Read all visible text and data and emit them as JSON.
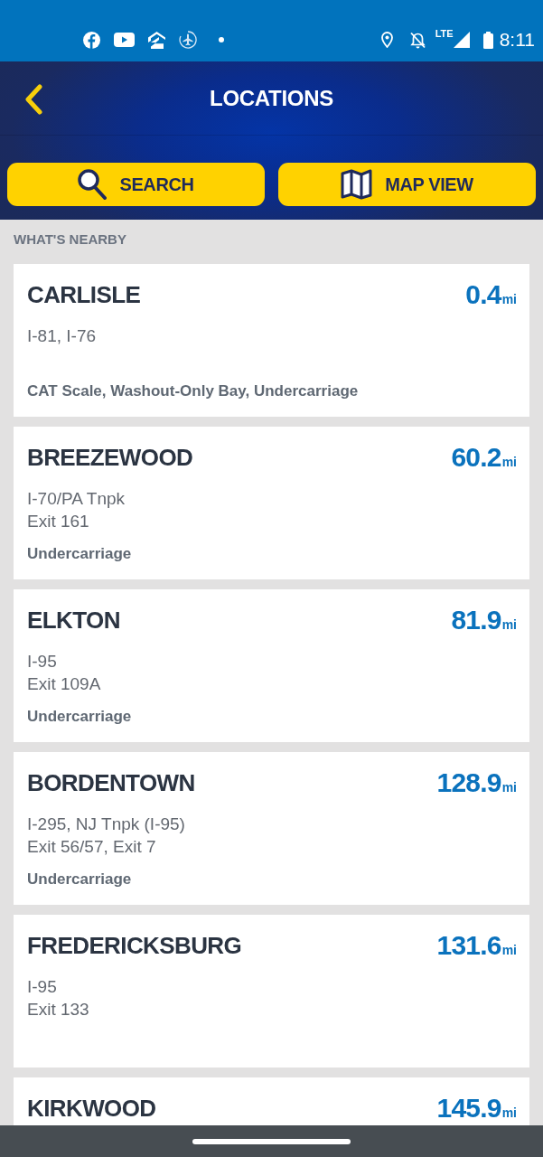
{
  "status_bar": {
    "network": "LTE",
    "time": "8:11"
  },
  "header": {
    "title": "LOCATIONS"
  },
  "actions": [
    {
      "kind": "search",
      "label": "SEARCH"
    },
    {
      "kind": "map",
      "label": "MAP VIEW"
    }
  ],
  "section": {
    "title": "WHAT'S NEARBY"
  },
  "locations": [
    {
      "name": "CARLISLE",
      "distance": "0.4",
      "unit": "mi",
      "roads": [
        "I-81, I-76"
      ],
      "amenities": "CAT Scale, Washout-Only Bay, Undercarriage"
    },
    {
      "name": "BREEZEWOOD",
      "distance": "60.2",
      "unit": "mi",
      "roads": [
        "I-70/PA Tnpk",
        "Exit 161"
      ],
      "amenities": "Undercarriage"
    },
    {
      "name": "ELKTON",
      "distance": "81.9",
      "unit": "mi",
      "roads": [
        "I-95",
        "Exit 109A"
      ],
      "amenities": "Undercarriage"
    },
    {
      "name": "BORDENTOWN",
      "distance": "128.9",
      "unit": "mi",
      "roads": [
        "I-295, NJ Tnpk (I-95)",
        "Exit 56/57, Exit 7"
      ],
      "amenities": "Undercarriage"
    },
    {
      "name": "FREDERICKSBURG",
      "distance": "131.6",
      "unit": "mi",
      "roads": [
        "I-95",
        "Exit 133"
      ]
    },
    {
      "name": "KIRKWOOD",
      "distance": "145.9",
      "unit": "mi"
    }
  ]
}
